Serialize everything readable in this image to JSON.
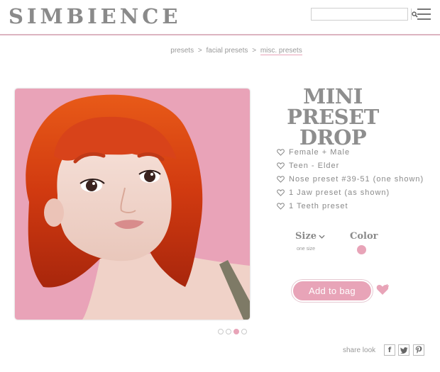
{
  "header": {
    "logo": "SIMBIENCE",
    "search": {
      "placeholder": "",
      "value": ""
    }
  },
  "breadcrumb": [
    {
      "label": "presets"
    },
    {
      "label": "facial presets"
    },
    {
      "label": "misc. presets"
    }
  ],
  "breadcrumb_separator": ">",
  "product": {
    "title": "MINI PRESET DROP",
    "features": [
      "Female + Male",
      "Teen - Elder",
      "Nose preset #39-51 (one shown)",
      "1 Jaw preset (as shown)",
      "1 Teeth preset"
    ],
    "size_label": "Size",
    "size_value": "one size",
    "color_label": "Color",
    "color_swatch": "#e8a4b8",
    "add_to_bag": "Add to bag",
    "image": {
      "background": "#e9a3b8",
      "hair": "#d13a10",
      "skin": "#f1d6cd"
    }
  },
  "carousel": {
    "count": 4,
    "active_index": 2
  },
  "share": {
    "label": "share look",
    "icons": [
      "facebook-icon",
      "twitter-icon",
      "pinterest-icon"
    ]
  },
  "colors": {
    "accent": "#e8a4b8",
    "divider": "#dcb4c0",
    "text": "#8a8a8a"
  }
}
